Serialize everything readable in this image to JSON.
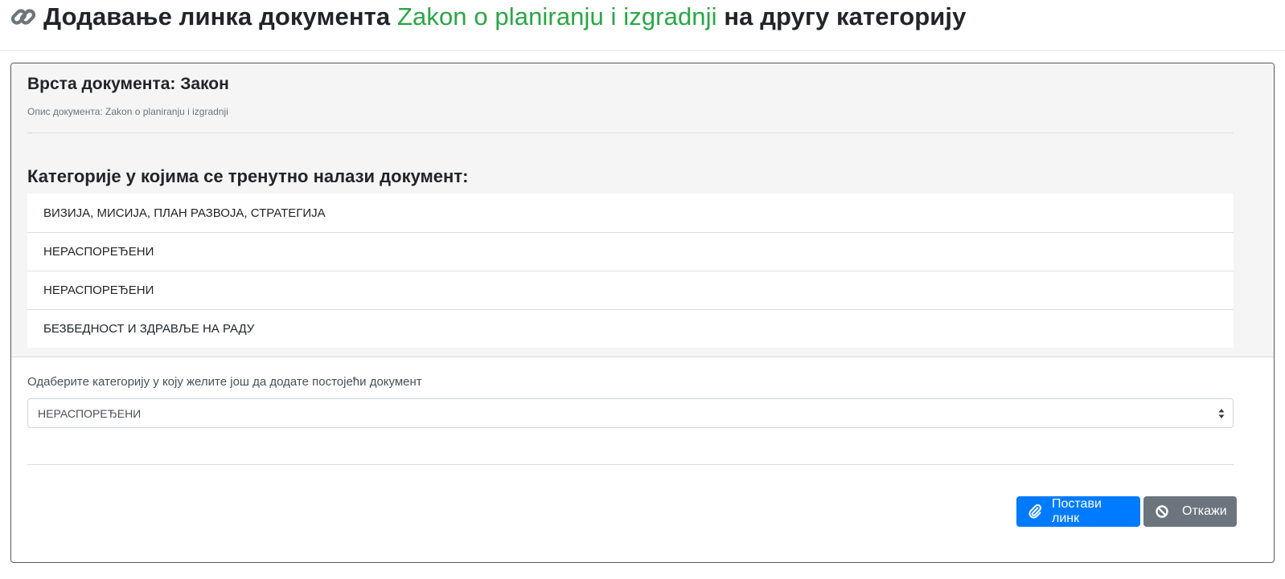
{
  "header": {
    "icon": "link-icon",
    "title_prefix": "Додавање линка документа ",
    "document_name": "Zakon o planiranju i izgradnji",
    "title_suffix": " на другу категорију",
    "accent_color": "#28a745"
  },
  "document": {
    "type_label": "Врста документа: Закон",
    "description": "Опис документа: Zakon o planiranju i izgradnji"
  },
  "categories": {
    "heading": "Категорије у којима се тренутно налази документ:",
    "items": [
      "ВИЗИЈА, МИСИЈА, ПЛАН РАЗВОЈА, СТРАТЕГИЈА",
      "НЕРАСПОРЕЂЕНИ",
      "НЕРАСПОРЕЂЕНИ",
      "БЕЗБЕДНОСТ И ЗДРАВЉЕ НА РАДУ"
    ]
  },
  "form": {
    "select_label": "Одаберите категорију у коју желите још да додате постојећи документ",
    "selected_value": "НЕРАСПОРЕЂЕНИ"
  },
  "actions": {
    "submit_label": "Постави линк",
    "submit_icon": "paperclip-icon",
    "submit_color": "#007bff",
    "cancel_label": "Откажи",
    "cancel_icon": "ban-icon",
    "cancel_color": "#6c757d"
  }
}
